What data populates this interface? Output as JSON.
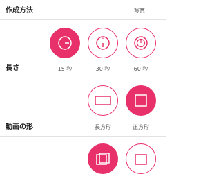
{
  "colors": {
    "accent": "#e8306a",
    "text": "#222222",
    "caption": "#555555"
  },
  "creation_method": {
    "title": "作成方法",
    "photo_option_label": "写真"
  },
  "length": {
    "title": "長さ",
    "options": [
      {
        "label": "15 秒",
        "selected": true,
        "icon": "timer-15-icon"
      },
      {
        "label": "30 秒",
        "selected": false,
        "icon": "timer-30-icon"
      },
      {
        "label": "60 秒",
        "selected": false,
        "icon": "timer-60-icon"
      }
    ]
  },
  "video_shape": {
    "title": "動画の形",
    "options": [
      {
        "label": "長方形",
        "selected": false,
        "icon": "landscape-rect-icon"
      },
      {
        "label": "正方形",
        "selected": true,
        "icon": "square-icon"
      }
    ]
  },
  "bottom_section": {
    "options": [
      {
        "selected": true,
        "icon": "stacked-frames-icon"
      },
      {
        "selected": false,
        "icon": "single-frame-icon"
      }
    ]
  }
}
